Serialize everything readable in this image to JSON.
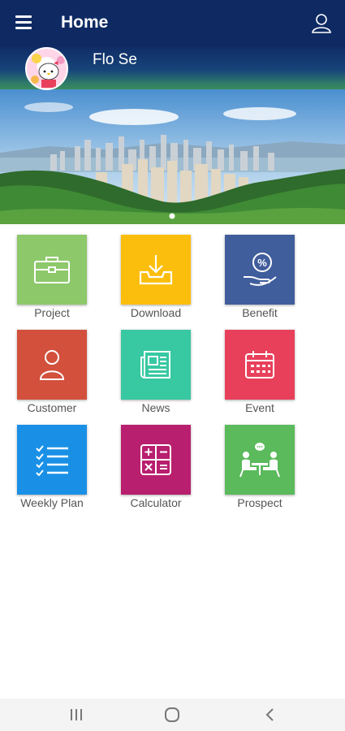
{
  "header": {
    "title": "Home",
    "menu_icon": "hamburger-menu-icon",
    "profile_icon": "user-profile-icon"
  },
  "user": {
    "name": "Flo Se"
  },
  "menu_tiles": [
    {
      "label": "Project",
      "icon": "briefcase-icon",
      "color": "#8dc86a"
    },
    {
      "label": "Download",
      "icon": "download-tray-icon",
      "color": "#fcbe0c"
    },
    {
      "label": "Benefit",
      "icon": "percent-hand-icon",
      "color": "#405d9c"
    },
    {
      "label": "Customer",
      "icon": "person-icon",
      "color": "#d2503c"
    },
    {
      "label": "News",
      "icon": "newspaper-icon",
      "color": "#38c8a2"
    },
    {
      "label": "Event",
      "icon": "calendar-icon",
      "color": "#e8405b"
    },
    {
      "label": "Weekly Plan",
      "icon": "checklist-icon",
      "color": "#1990e6"
    },
    {
      "label": "Calculator",
      "icon": "calculator-icon",
      "color": "#b81f6e"
    },
    {
      "label": "Prospect",
      "icon": "meeting-icon",
      "color": "#5bba5c"
    }
  ],
  "system_nav": {
    "recents_icon": "recents-icon",
    "home_icon": "home-circle-icon",
    "back_icon": "back-chevron-icon"
  }
}
